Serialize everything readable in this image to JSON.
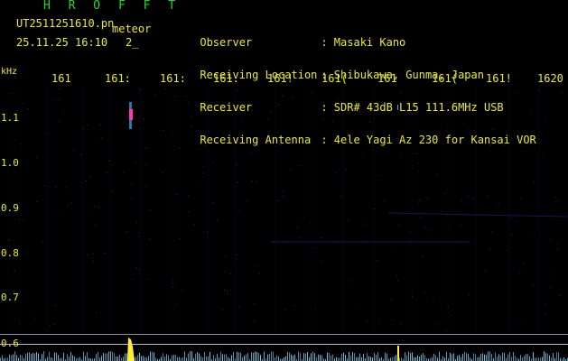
{
  "header": {
    "app_title": "H R O F F T",
    "file_name": "UT2511251610.pn",
    "file_tag": "meteor",
    "date_time": "25.11.25 16:10",
    "channel": "2_"
  },
  "meta": [
    {
      "key": "Observer",
      "value": ": Masaki Kano"
    },
    {
      "key": "Receiving Location",
      "value": ": Shibukawa, Gunma, Japan"
    },
    {
      "key": "Receiver",
      "value": ": SDR# 43dB L15 111.6MHz USB"
    },
    {
      "key": "Receiving Antenna",
      "value": ": 4ele Yagi Az 230 for Kansai VOR"
    }
  ],
  "freq_axis": {
    "unit": "kHz",
    "ticks": [
      "161",
      "161:",
      "161:",
      "161.",
      "161!",
      "161(",
      "161",
      "161(",
      "161!",
      "1620"
    ]
  },
  "y_axis": {
    "labels": [
      "1.1",
      "1.0",
      "0.9",
      "0.8",
      "0.7",
      "0.6"
    ]
  },
  "colors": {
    "text": "#e8e840",
    "title": "#2bd42b",
    "echo": "#ff3aa8",
    "echo_halo": "#3aa8ff",
    "baseline": "#7fd8ff",
    "burst": "#ffee33",
    "noise": "#2a2aa8"
  }
}
